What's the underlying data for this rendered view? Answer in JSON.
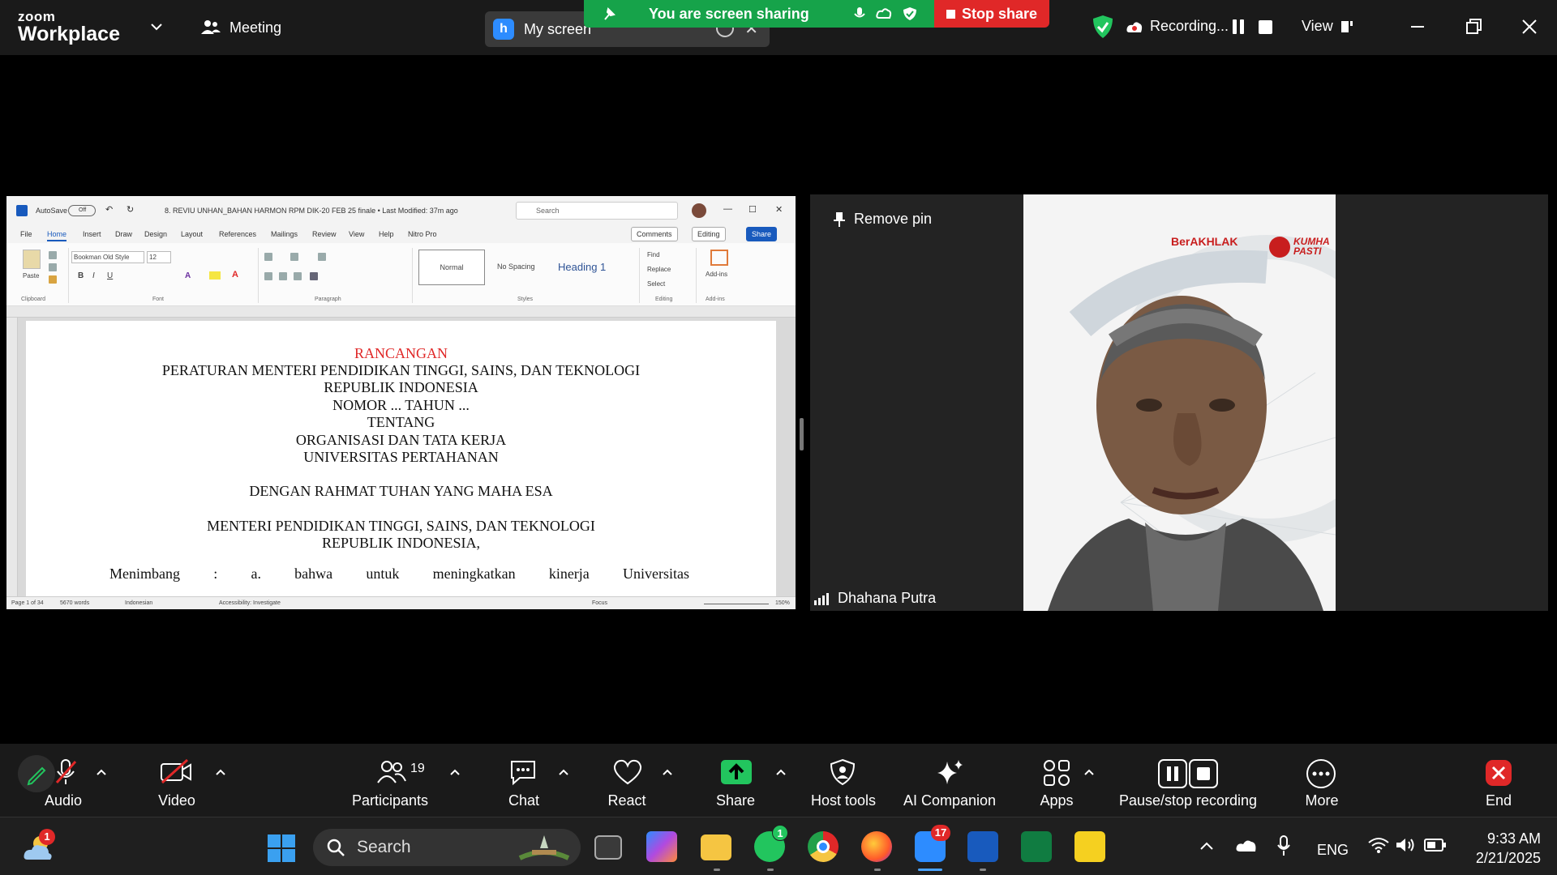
{
  "zoom": {
    "logo_line1": "zoom",
    "logo_line2": "Workplace",
    "meeting_label": "Meeting",
    "share_source": {
      "initial": "h",
      "label": "My screen"
    },
    "sharing_banner": "You are screen sharing",
    "stop_share_label": "Stop share",
    "recording_label": "Recording...",
    "view_label": "View",
    "colors": {
      "banner": "#16a34a",
      "stop": "#e02828",
      "bar": "#1a1a1a",
      "accent": "#2d8cff"
    }
  },
  "word": {
    "autosave": "AutoSave",
    "toggle": "Off",
    "filename": "8. REVIU UNHAN_BAHAN HARMON RPM DIK-20 FEB 25 finale • Last Modified: 37m ago",
    "search_placeholder": "Search",
    "tabs": [
      "File",
      "Home",
      "Insert",
      "Draw",
      "Design",
      "Layout",
      "References",
      "Mailings",
      "Review",
      "View",
      "Help",
      "Nitro Pro"
    ],
    "comments": "Comments",
    "editing": "Editing",
    "share": "Share",
    "ribbon": {
      "paste": "Paste",
      "font_name": "Bookman Old Style",
      "font_size": "12",
      "style_normal": "Normal",
      "style_nospacing": "No Spacing",
      "style_heading1": "Heading 1",
      "find": "Find",
      "replace": "Replace",
      "select": "Select",
      "addins": "Add-ins",
      "groups": [
        "Clipboard",
        "Font",
        "Paragraph",
        "Styles",
        "Editing",
        "Add-ins"
      ]
    },
    "document_lines": [
      "RANCANGAN",
      "PERATURAN MENTERI PENDIDIKAN TINGGI, SAINS, DAN TEKNOLOGI",
      "REPUBLIK INDONESIA",
      "NOMOR ... TAHUN ...",
      "TENTANG",
      "ORGANISASI DAN TATA KERJA",
      "UNIVERSITAS PERTAHANAN",
      "DENGAN RAHMAT TUHAN YANG MAHA ESA",
      "MENTERI PENDIDIKAN TINGGI, SAINS, DAN TEKNOLOGI",
      "REPUBLIK INDONESIA,"
    ],
    "menimbang_words": [
      "Menimbang",
      ":",
      "a.",
      "bahwa",
      "untuk",
      "meningkatkan",
      "kinerja",
      "Universitas"
    ],
    "status": {
      "page": "Page 1 of 34",
      "words": "5670 words",
      "language": "Indonesian",
      "accessibility": "Accessibility: Investigate",
      "focus": "Focus",
      "zoom": "150%"
    }
  },
  "video": {
    "remove_pin": "Remove pin",
    "participant": "Dhahana Putra",
    "backdrop_brand1": "BerAKHLAK",
    "backdrop_brand2": "KUMHA PASTI"
  },
  "controls": {
    "audio": "Audio",
    "video": "Video",
    "participants": "Participants",
    "participants_count": "19",
    "chat": "Chat",
    "react": "React",
    "share": "Share",
    "host_tools": "Host tools",
    "ai_companion": "AI Companion",
    "apps": "Apps",
    "pause_stop_recording": "Pause/stop recording",
    "more": "More",
    "end": "End"
  },
  "taskbar": {
    "search_label": "Search",
    "weather_badge": "1",
    "whatsapp_badge": "1",
    "zoom_badge": "17",
    "language": "ENG",
    "time": "9:33 AM",
    "date": "2/21/2025"
  }
}
